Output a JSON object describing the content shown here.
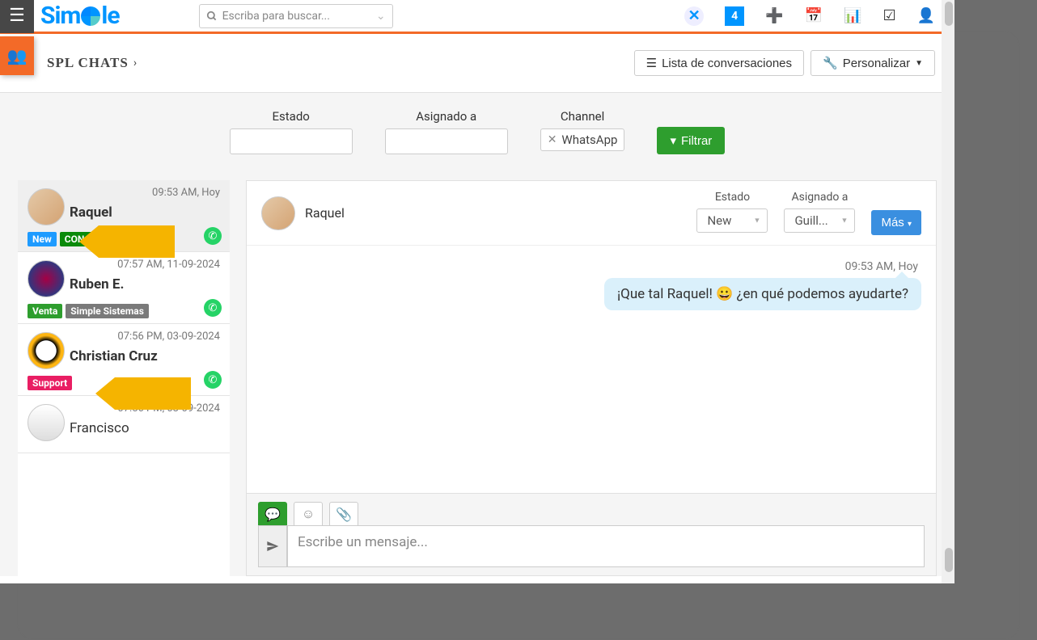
{
  "header": {
    "logo_text": "Simple",
    "search_placeholder": "Escriba para buscar..."
  },
  "titlebar": {
    "title": "SPL CHATS",
    "btn_list": "Lista de conversaciones",
    "btn_customize": "Personalizar"
  },
  "filters": {
    "estado_label": "Estado",
    "asignado_label": "Asignado a",
    "channel_label": "Channel",
    "channel_value": "WhatsApp",
    "filter_btn": "Filtrar"
  },
  "conversations": [
    {
      "time": "09:53 AM, Hoy",
      "name": "Raquel",
      "bold": true,
      "badges": [
        [
          "New",
          "blue"
        ],
        [
          "CON4",
          "darkgreen"
        ]
      ]
    },
    {
      "time": "07:57 AM, 11-09-2024",
      "name": "Ruben E.",
      "bold": true,
      "badges": [
        [
          "Venta",
          "green"
        ],
        [
          "Simple Sistemas",
          "gray"
        ]
      ]
    },
    {
      "time": "07:56 PM, 03-09-2024",
      "name": "Christian Cruz",
      "bold": true,
      "badges": [
        [
          "Support",
          "pink"
        ]
      ]
    },
    {
      "time": "07:56 PM, 03-09-2024",
      "name": "Francisco",
      "bold": false,
      "badges": []
    }
  ],
  "chat": {
    "contact_name": "Raquel",
    "estado_label": "Estado",
    "estado_value": "New",
    "asignado_label": "Asignado a",
    "asignado_value": "Guill...",
    "more_btn": "Más",
    "msg_time": "09:53 AM, Hoy",
    "msg_text": "¡Que tal Raquel! 😀 ¿en qué podemos ayudarte?",
    "composer_placeholder": "Escribe un mensaje..."
  }
}
